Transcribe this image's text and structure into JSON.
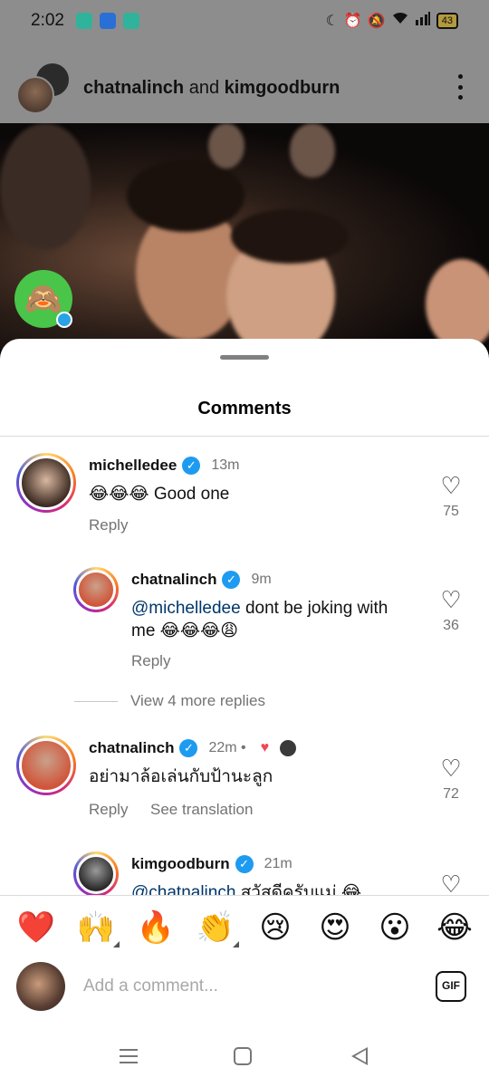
{
  "status_bar": {
    "time": "2:02",
    "battery": "43"
  },
  "post_header": {
    "user1": "chatnalinch",
    "connector": " and ",
    "user2": "kimgoodburn"
  },
  "sheet": {
    "title": "Comments"
  },
  "comments": [
    {
      "username": "michelledee",
      "time": "13m",
      "text": "😂😂😂 Good one",
      "reply_label": "Reply",
      "likes": "75"
    },
    {
      "username": "chatnalinch",
      "time": "9m",
      "mention": "@michelledee",
      "text": " dont be joking with me 😂😂😂😩",
      "reply_label": "Reply",
      "likes": "36"
    },
    {
      "username": "chatnalinch",
      "time": "22m •",
      "text": "อย่ามาล้อเล่นกับป้านะลูก",
      "reply_label": "Reply",
      "translate_label": "See translation",
      "likes": "72"
    },
    {
      "username": "kimgoodburn",
      "time": "21m",
      "mention": "@chatnalinch",
      "text": " สวัสดีครับแม่ 😂"
    }
  ],
  "view_more": "View 4 more replies",
  "reactions": [
    "❤️",
    "🙌",
    "🔥",
    "👏",
    "😢",
    "😍",
    "😮",
    "😂"
  ],
  "composer": {
    "placeholder": "Add a comment...",
    "gif_label": "GIF"
  }
}
